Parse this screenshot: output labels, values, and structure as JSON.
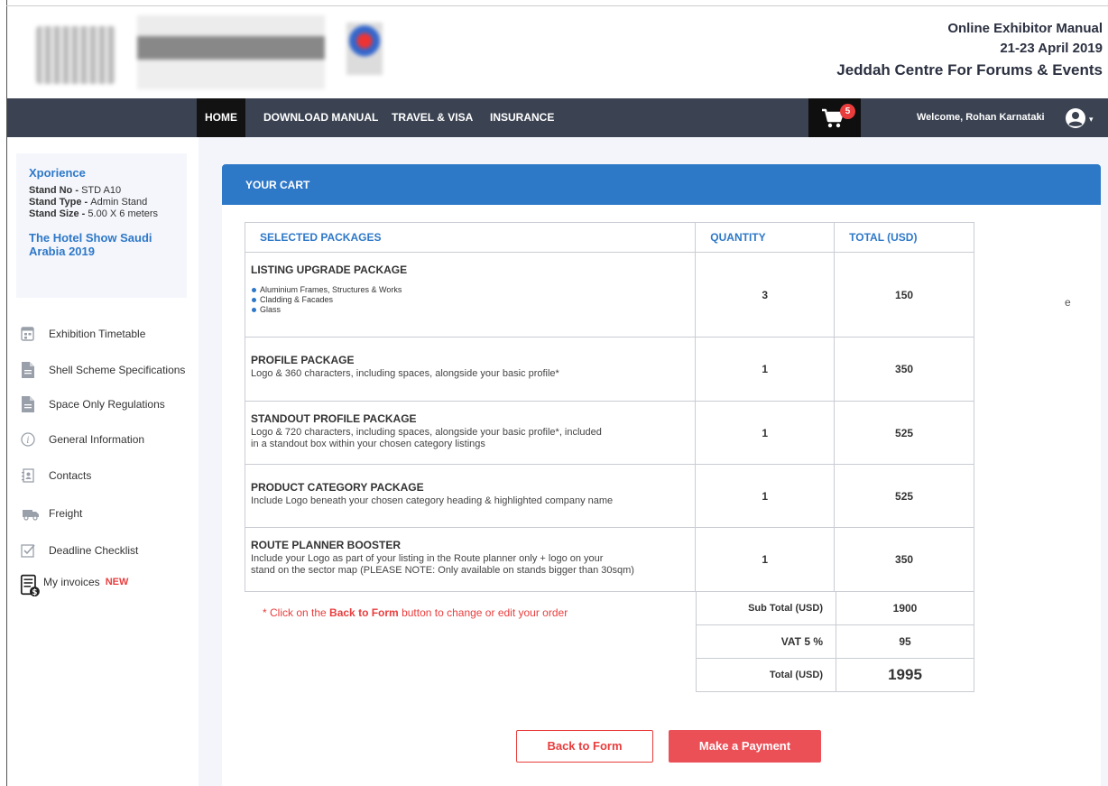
{
  "header": {
    "line1": "Online Exhibitor Manual",
    "line2": "21-23 April 2019",
    "line3": "Jeddah Centre For Forums & Events"
  },
  "nav": {
    "home": "HOME",
    "manual": "DOWNLOAD MANUAL",
    "travel": "TRAVEL & VISA",
    "insurance": "INSURANCE",
    "cart_count": "5",
    "welcome": "Welcome, Rohan Karnataki"
  },
  "profile": {
    "company": "Xporience",
    "stand_no_label": "Stand No - ",
    "stand_no": "STD A10",
    "stand_type_label": "Stand Type - ",
    "stand_type": "Admin Stand",
    "stand_size_label": "Stand Size - ",
    "stand_size": "5.00 X 6 meters",
    "event": "The Hotel Show Saudi Arabia 2019"
  },
  "sidebar": {
    "items": [
      {
        "label": "Exhibition Timetable",
        "icon": "calendar-icon"
      },
      {
        "label": "Shell Scheme Specifications",
        "icon": "document-icon"
      },
      {
        "label": "Space Only Regulations",
        "icon": "document-icon"
      },
      {
        "label": "General Information",
        "icon": "info-icon"
      },
      {
        "label": "Contacts",
        "icon": "contacts-icon"
      },
      {
        "label": "Freight",
        "icon": "truck-icon"
      },
      {
        "label": "Deadline Checklist",
        "icon": "checklist-icon"
      },
      {
        "label": "My invoices",
        "icon": "invoice-icon",
        "badge": "NEW"
      }
    ]
  },
  "cart": {
    "title": "YOUR CART",
    "stray": "e",
    "columns": [
      "SELECTED PACKAGES",
      "QUANTITY",
      "TOTAL (USD)"
    ],
    "rows": [
      {
        "title": "LISTING UPGRADE PACKAGE",
        "bullets": [
          "Aluminium Frames, Structures & Works",
          "Cladding & Facades",
          "Glass"
        ],
        "qty": "3",
        "total": "150"
      },
      {
        "title": "PROFILE PACKAGE",
        "desc": "Logo & 360 characters, including spaces, alongside your basic profile*",
        "qty": "1",
        "total": "350"
      },
      {
        "title": "STANDOUT PROFILE PACKAGE",
        "desc_l1": "Logo & 720 characters, including spaces, alongside your basic profile*, included",
        "desc_l2": "in a standout box within your chosen category listings",
        "qty": "1",
        "total": "525"
      },
      {
        "title": "PRODUCT CATEGORY PACKAGE",
        "desc": "Include Logo beneath your chosen category heading & highlighted company name",
        "qty": "1",
        "total": "525"
      },
      {
        "title": "ROUTE PLANNER BOOSTER",
        "desc_l1": "Include your Logo as part of your listing in the Route planner only + logo on your",
        "desc_l2": "stand on the sector map (PLEASE NOTE: Only available on stands bigger than 30sqm)",
        "qty": "1",
        "total": "350"
      }
    ],
    "note_pre": "* Click on the ",
    "note_bold": "Back to Form",
    "note_post": " button to change or edit your order",
    "subtotal_label": "Sub Total (USD)",
    "subtotal": "1900",
    "vat_label": "VAT 5 %",
    "vat": "95",
    "total_label": "Total (USD)",
    "total": "1995",
    "back_button": "Back to Form",
    "pay_button": "Make a Payment"
  },
  "colors": {
    "nav_bg": "#3b4352",
    "accent_blue": "#2e78c8",
    "accent_red": "#e93d3d"
  }
}
